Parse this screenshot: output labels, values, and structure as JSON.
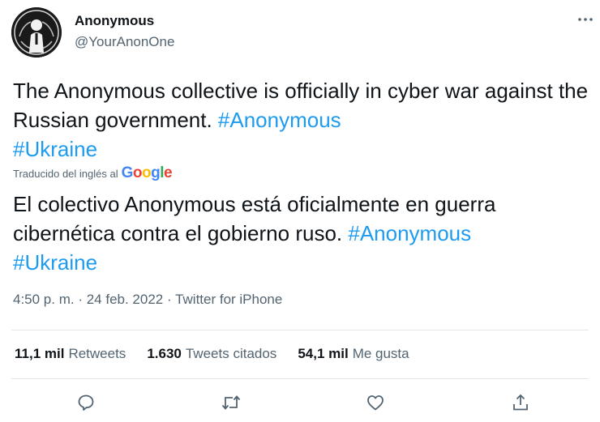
{
  "author": {
    "name": "Anonymous",
    "handle": "@YourAnonOne",
    "avatar_icon": "anonymous-logo-icon"
  },
  "tweet": {
    "text_plain": "The Anonymous collective is officially in cyber war against the Russian government. ",
    "hashtag_1": "#Anonymous",
    "hashtag_2": "#Ukraine"
  },
  "translation": {
    "label": "Traducido del inglés al",
    "provider": "Google",
    "text_plain": "El colectivo Anonymous está oficialmente en guerra cibernética contra el gobierno ruso. ",
    "hashtag_1": "#Anonymous",
    "hashtag_2": "#Ukraine"
  },
  "meta": {
    "time": "4:50 p. m.",
    "separator": " · ",
    "date": "24 feb. 2022",
    "source": "Twitter for iPhone"
  },
  "stats": [
    {
      "value": "11,1 mil",
      "label": "Retweets"
    },
    {
      "value": "1.630",
      "label": "Tweets citados"
    },
    {
      "value": "54,1 mil",
      "label": "Me gusta"
    }
  ],
  "actions": [
    "reply-icon",
    "retweet-icon",
    "like-icon",
    "share-icon"
  ],
  "colors": {
    "text": "#0f1419",
    "secondary": "#536471",
    "link": "#1d9bf0",
    "divider": "#e3e7ea"
  }
}
